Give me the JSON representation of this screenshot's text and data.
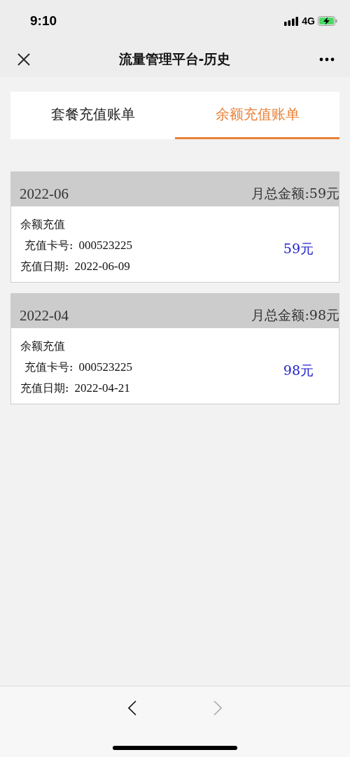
{
  "status_bar": {
    "time": "9:10",
    "network": "4G"
  },
  "nav": {
    "title": "流量管理平台-历史"
  },
  "tabs": [
    {
      "label": "套餐充值账单",
      "selected": false
    },
    {
      "label": "余额充值账单",
      "selected": true
    }
  ],
  "months": [
    {
      "month": "2022-06",
      "total": "月总金额:59元",
      "records": [
        {
          "type": "余额充值",
          "card_label": "充值卡号:",
          "card": "000523225",
          "date_label": "充值日期:",
          "date": "2022-06-09",
          "amount": "59元"
        }
      ]
    },
    {
      "month": "2022-04",
      "total": "月总金额:98元",
      "records": [
        {
          "type": "余额充值",
          "card_label": "充值卡号:",
          "card": "000523225",
          "date_label": "充值日期:",
          "date": "2022-04-21",
          "amount": "98元"
        }
      ]
    }
  ],
  "toolbar": {
    "back_disabled": false,
    "forward_disabled": true
  }
}
